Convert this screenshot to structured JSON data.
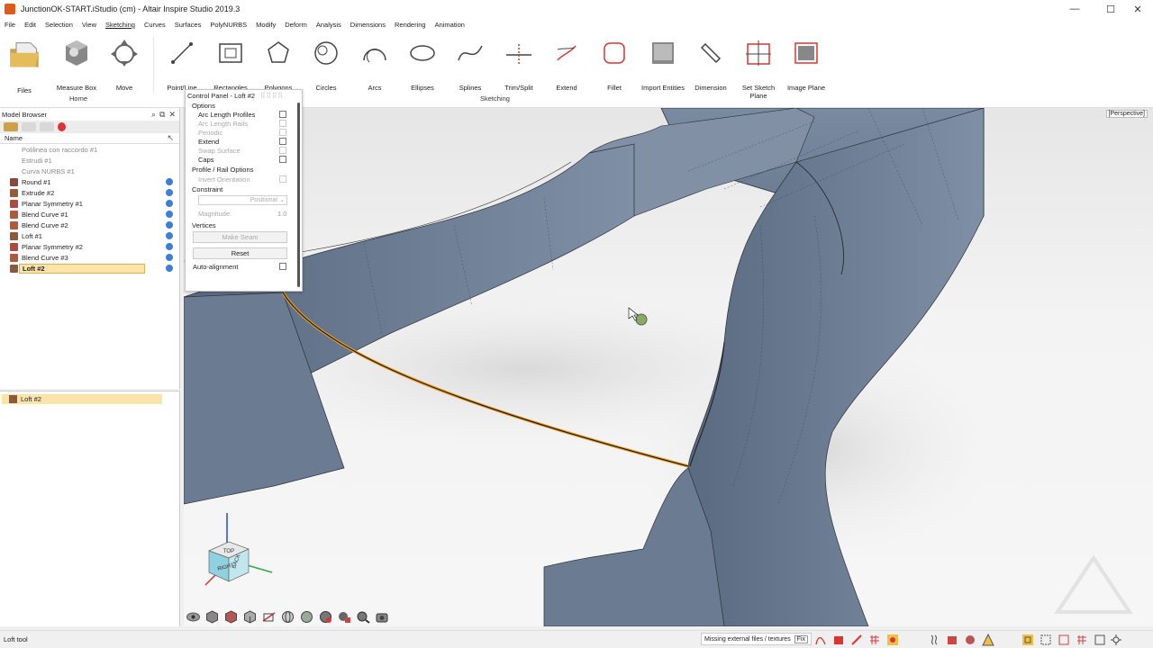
{
  "window": {
    "title": "JunctionOK-START.iStudio (cm) - Altair Inspire Studio 2019.3",
    "minimize": "—",
    "maximize": "☐",
    "close": "✕"
  },
  "menu": [
    "File",
    "Edit",
    "Selection",
    "View",
    "Sketching",
    "Curves",
    "Surfaces",
    "PolyNURBS",
    "Modify",
    "Deform",
    "Analysis",
    "Dimensions",
    "Rendering",
    "Animation"
  ],
  "menu_active": "Sketching",
  "ribbon": {
    "home_group": "Home",
    "sketching_group": "Sketching",
    "tools": {
      "files": "Files",
      "measure_box": "Measure Box",
      "move": "Move",
      "point_line": "Point/Line",
      "rectangles": "Rectangles",
      "polygons": "Polygons",
      "circles": "Circles",
      "arcs": "Arcs",
      "ellipses": "Ellipses",
      "splines": "Splines",
      "trim_split": "Trim/Split",
      "extend": "Extend",
      "fillet": "Fillet",
      "import_entities": "Import Entities",
      "dimension": "Dimension",
      "set_sketch_plane_1": "Set Sketch",
      "set_sketch_plane_2": "Plane",
      "image_plane": "Image Plane"
    }
  },
  "model_browser": {
    "title": "Model Browser",
    "column": "Name",
    "items": [
      {
        "label": "Polilinea con raccordo #1",
        "dim": true,
        "check": false
      },
      {
        "label": "Estrudi #1",
        "dim": true,
        "check": false
      },
      {
        "label": "Curva NURBS #1",
        "dim": true,
        "check": false
      },
      {
        "label": "Round #1",
        "dim": false,
        "check": true
      },
      {
        "label": "Extrude #2",
        "dim": false,
        "check": true
      },
      {
        "label": "Planar Symmetry #1",
        "dim": false,
        "check": true
      },
      {
        "label": "Blend Curve #1",
        "dim": false,
        "check": true
      },
      {
        "label": "Blend Curve #2",
        "dim": false,
        "check": true
      },
      {
        "label": "Loft #1",
        "dim": false,
        "check": true
      },
      {
        "label": "Planar Symmetry #2",
        "dim": false,
        "check": true
      },
      {
        "label": "Blend Curve #3",
        "dim": false,
        "check": true
      },
      {
        "label": "Loft #2",
        "dim": false,
        "check": true,
        "selected": true
      }
    ]
  },
  "property_panel": {
    "item": "Loft #2"
  },
  "control_panel": {
    "title": "Control Panel - Loft #2",
    "options_header": "Options",
    "arc_length_profiles": "Arc Length Profiles",
    "arc_length_rails": "Arc Length Rails",
    "periodic": "Periodic",
    "extend": "Extend",
    "swap_surface": "Swap Surface",
    "caps": "Caps",
    "profile_rail_header": "Profile / Rail Options",
    "invert_orientation": "Invert Orientation",
    "constraint_header": "Constraint",
    "constraint_value": "Positional",
    "magnitude_label": "Magnitude:",
    "magnitude_value": "1.0",
    "vertices_header": "Vertices",
    "make_seam": "Make Seam",
    "reset": "Reset",
    "auto_alignment": "Auto-alignment"
  },
  "viewport": {
    "projection": "[Perspective]",
    "view_cube": {
      "front": "RIGHT",
      "side": "BACK",
      "top": "TOP"
    }
  },
  "status": {
    "tool": "Loft tool",
    "missing": "Missing external files / textures",
    "fix": "Fix"
  },
  "colors": {
    "surface": "#6d7f95",
    "surface_dark": "#55657a",
    "selection": "#f0a020",
    "tree_selected": "#fbe4a8",
    "check": "#3b7fd6"
  }
}
